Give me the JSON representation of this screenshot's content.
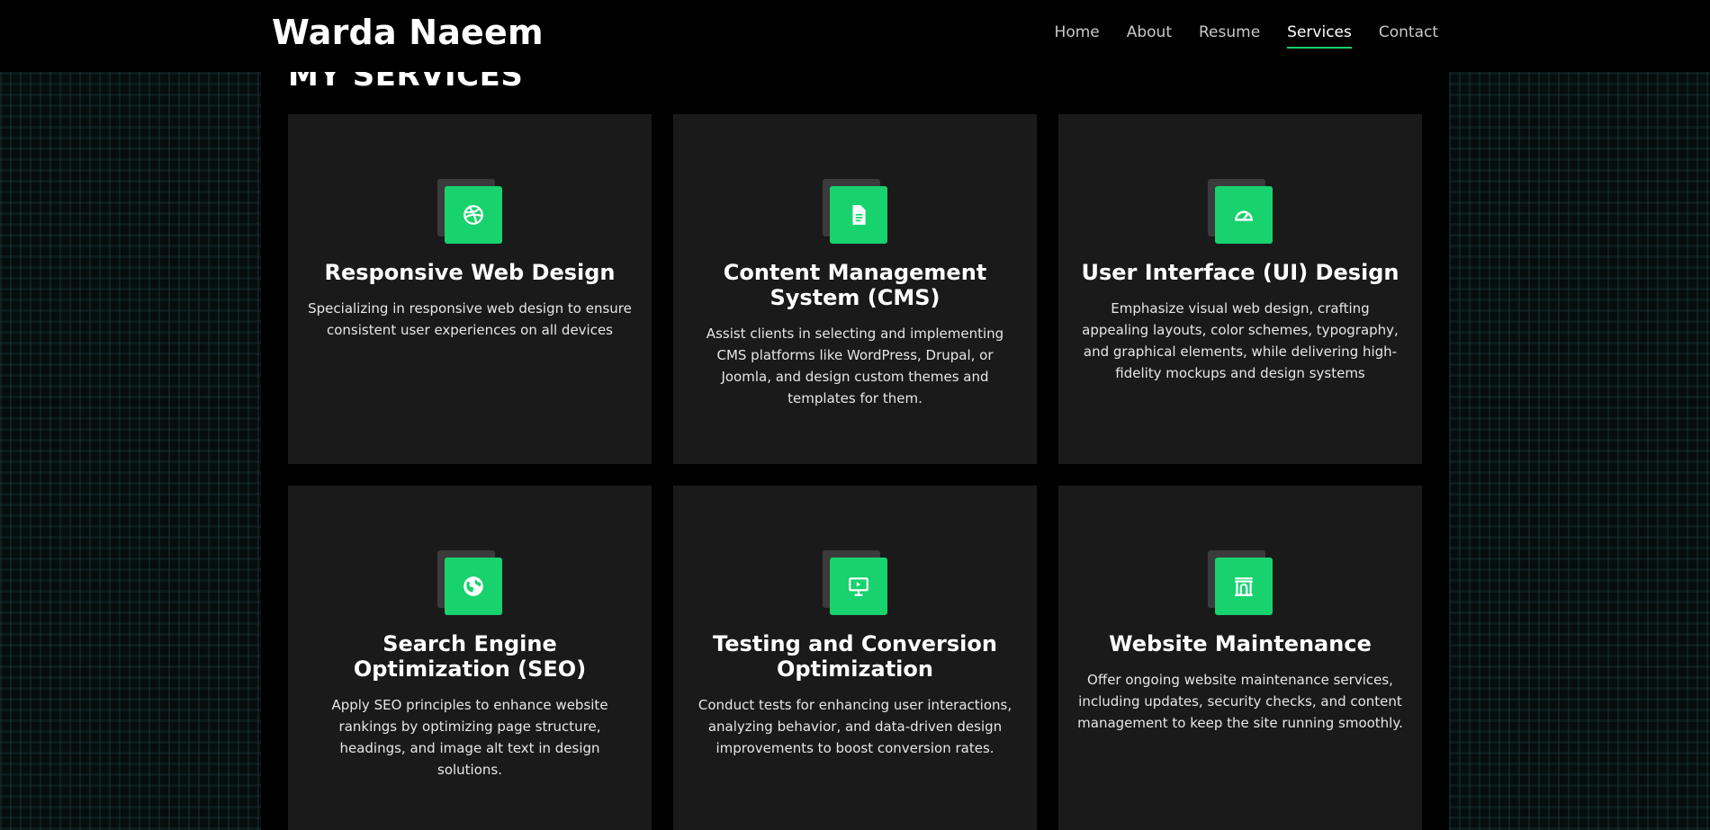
{
  "header": {
    "brand": "Warda Naeem",
    "nav": [
      {
        "label": "Home",
        "active": false
      },
      {
        "label": "About",
        "active": false
      },
      {
        "label": "Resume",
        "active": false
      },
      {
        "label": "Services",
        "active": true
      },
      {
        "label": "Contact",
        "active": false
      }
    ]
  },
  "section": {
    "title": "MY SERVICES"
  },
  "services": [
    {
      "icon": "dribbble-icon",
      "title": "Responsive Web Design",
      "description": "Specializing in responsive web design to ensure consistent user experiences on all devices"
    },
    {
      "icon": "file-text-icon",
      "title": "Content Management System (CMS)",
      "description": "Assist clients in selecting and implementing CMS platforms like WordPress, Drupal, or Joomla, and design custom themes and templates for them."
    },
    {
      "icon": "speedometer-icon",
      "title": "User Interface (UI) Design",
      "description": "Emphasize visual web design, crafting appealing layouts, color schemes, typography, and graphical elements, while delivering high-fidelity mockups and design systems"
    },
    {
      "icon": "globe-icon",
      "title": "Search Engine Optimization (SEO)",
      "description": "Apply SEO principles to enhance website rankings by optimizing page structure, headings, and image alt text in design solutions."
    },
    {
      "icon": "presentation-icon",
      "title": "Testing and Conversion Optimization",
      "description": "Conduct tests for enhancing user interactions, analyzing behavior, and data-driven design improvements to boost conversion rates."
    },
    {
      "icon": "archway-icon",
      "title": "Website Maintenance",
      "description": "Offer ongoing website maintenance services, including updates, security checks, and content management to keep the site running smoothly."
    }
  ],
  "colors": {
    "accent": "#18d26e",
    "card_bg": "#1a1a1a",
    "page_bg": "#000000"
  }
}
